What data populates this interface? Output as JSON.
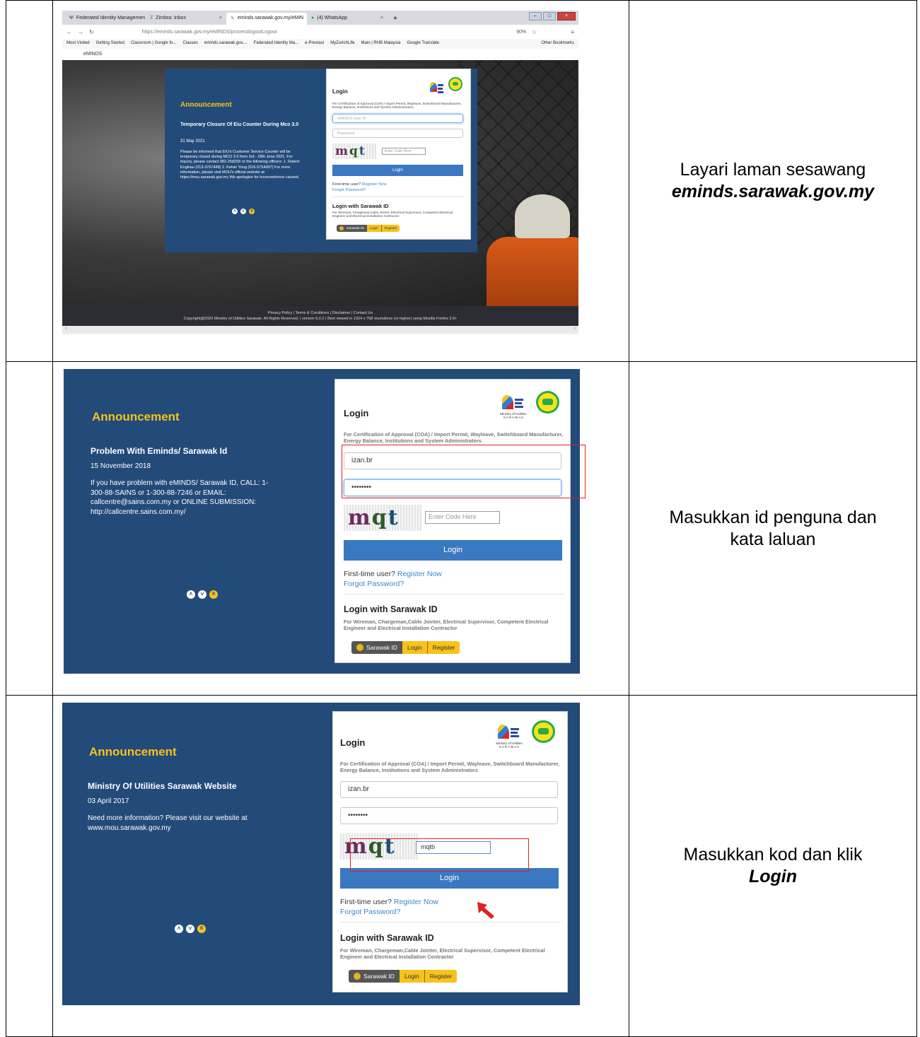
{
  "row1": {
    "browser": {
      "tabs": [
        {
          "label": "Federated Identity Managemen",
          "icon": "federated-icon"
        },
        {
          "label": "Zimbra: Inbox",
          "icon": "zimbra-icon"
        },
        {
          "label": "eminds.sarawak.gov.my/eMIN",
          "icon": "eminds-icon"
        },
        {
          "label": "(4) WhatsApp",
          "icon": "whatsapp-icon"
        }
      ],
      "url": "https://eminds.sarawak.gov.my/eMINDS/processlogoutLogout",
      "zoom": "90%",
      "bookmarks": [
        "Most Visited",
        "Getting Started",
        "Classroom | Google fo...",
        "Classes",
        "eminds.sarawak.gov....",
        "Federated Identity Ma...",
        "e-Prestasi",
        "MyZurichLife",
        "Main | RHB Malaysia",
        "Google Translate"
      ],
      "other_bookmarks": "Other Bookmarks",
      "app_name": "eMINDS"
    },
    "announcement": {
      "title": "Announcement",
      "headline": "Temporary Closure Of Eiu Counter During Mco 3.0",
      "date": "31 May 2021",
      "body": "Please be informed that EIU's Customer Service Counter will be temporary closed during MCO 3.0 from 3rd - 28th June 2021. For inquiry, please contact 082-258258 or the following officers: 1. Robert Engkiau (013-3767448) 2. Kelvin Yong (016-5754007) For more information, please visit MOU's official website at https://mou.sarawak.gov.my We apologize for inconvenience caused."
    },
    "login": {
      "title": "Login",
      "subtitle": "For Certification of Approval (COA) / Import Permit, Wayleave, Switchboard Manufacturer, Energy Balance, Institutions and System Administrators",
      "user_placeholder": "eMINDS User Id",
      "password_placeholder": "Password",
      "captcha": [
        "m",
        "q",
        "t",
        "b"
      ],
      "code_placeholder": "Enter Code Here",
      "button": "Login",
      "first_time": "First-time user?",
      "register": "Register Now",
      "forgot": "Forgot Password?",
      "sarawak_title": "Login with Sarawak ID",
      "sarawak_sub": "For Wireman, Chargeman,Cable Jointer, Electrical Supervisor, Competent Electrical Engineer and Electrical Installation Contractor",
      "sarawak_id": "Sarawak ID",
      "sarawak_login": "Login",
      "sarawak_register": "Register"
    },
    "footer": {
      "links": "Privacy Policy | Terms & Conditions | Disclaimer | Contact Us",
      "copyright": "Copyright@2020 Ministry of Utilities Sarawak. All Rights Reserved. | version 6.0.2 | Best viewed in 1024 x 768 resolutions (or higher) using Mozilla Firefox 3.0+"
    },
    "caption_line1": "Layari laman sesawang",
    "caption_bold": "eminds.sarawak.gov.my"
  },
  "row2": {
    "announcement": {
      "title": "Announcement",
      "headline": "Problem With Eminds/ Sarawak Id",
      "date": "15 November 2018",
      "body": "If you have problem with eMINDS/ Sarawak ID, CALL: 1-300-88-SAINS or 1-300-88-7246 or EMAIL: callcentre@sains.com.my or ONLINE SUBMISSION: http://callcentre.sains.com.my/"
    },
    "login": {
      "title": "Login",
      "logo_caption_1": "Ministry Of Utilities",
      "logo_caption_2": "S A R A W A K",
      "subtitle": "For Certification of Approval (COA) / Import Permit, Wayleave, Switchboard Manufacturer, Energy Balance, Institutions and System Administrators",
      "user_value": "izan.br",
      "password_value": "••••••••",
      "captcha": [
        "m",
        "q",
        "t",
        "b"
      ],
      "code_placeholder": "Enter Code Here",
      "button": "Login",
      "first_time": "First-time user?",
      "register": "Register Now",
      "forgot": "Forgot Password?",
      "sarawak_title": "Login with Sarawak ID",
      "sarawak_sub": "For Wireman, Chargeman,Cable Jointer, Electrical Supervisor, Competent Electrical Engineer and Electrical Installation Contractor",
      "sarawak_id": "Sarawak ID",
      "sarawak_login": "Login",
      "sarawak_register": "Register"
    },
    "caption": "Masukkan id penguna dan kata laluan"
  },
  "row3": {
    "announcement": {
      "title": "Announcement",
      "headline": "Ministry Of Utilities Sarawak Website",
      "date": "03 April 2017",
      "body": "Need more information? Please visit our website at www.mou.sarawak.gov.my"
    },
    "login": {
      "title": "Login",
      "logo_caption_1": "Ministry Of Utilities",
      "logo_caption_2": "S A R A W A K",
      "subtitle": "For Certification of Approval (COA) / Import Permit, Wayleave, Switchboard Manufacturer, Energy Balance, Institutions and System Administrators",
      "user_value": "izan.br",
      "password_value": "••••••••",
      "captcha": [
        "m",
        "q",
        "t",
        "b"
      ],
      "code_value": "mqtb",
      "button": "Login",
      "first_time": "First-time user?",
      "register": "Register Now",
      "forgot": "Forgot Password?",
      "sarawak_title": "Login with Sarawak ID",
      "sarawak_sub": "For Wireman, Chargeman,Cable Jointer, Electrical Supervisor, Competent Electrical Engineer and Electrical Installation Contractor",
      "sarawak_id": "Sarawak ID",
      "sarawak_login": "Login",
      "sarawak_register": "Register"
    },
    "caption_line1": "Masukkan kod dan klik",
    "caption_bold": "Login"
  },
  "colors": {
    "panel": "#234b79",
    "accent": "#f7c21a",
    "button": "#3a78c2",
    "highlight": "#e02222"
  }
}
